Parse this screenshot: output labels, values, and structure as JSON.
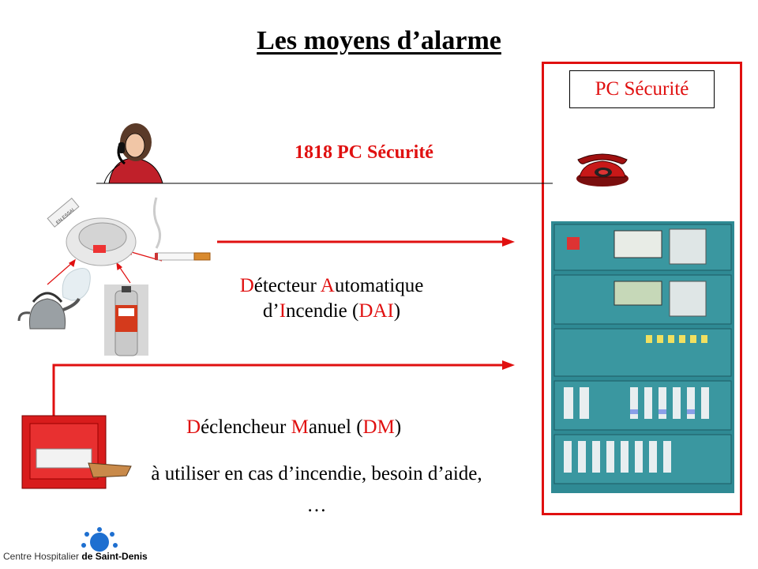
{
  "title": "Les moyens d’alarme",
  "pc_box": {
    "label": "PC Sécurité"
  },
  "phone_line": {
    "label": "1818  PC Sécurité"
  },
  "dai": {
    "line1": [
      {
        "t": "D",
        "red": true
      },
      {
        "t": "étecteur ",
        "red": false
      },
      {
        "t": "A",
        "red": true
      },
      {
        "t": "utomatique",
        "red": false
      }
    ],
    "line2": [
      {
        "t": "d’",
        "red": false
      },
      {
        "t": "I",
        "red": true
      },
      {
        "t": "ncendie (",
        "red": false
      },
      {
        "t": "DAI",
        "red": true
      },
      {
        "t": ")",
        "red": false
      }
    ]
  },
  "dm": {
    "line": [
      {
        "t": "D",
        "red": true
      },
      {
        "t": "éclencheur ",
        "red": false
      },
      {
        "t": "M",
        "red": true
      },
      {
        "t": "anuel (",
        "red": false
      },
      {
        "t": "DM",
        "red": true
      },
      {
        "t": ")",
        "red": false
      }
    ]
  },
  "usage": {
    "line1": "à utiliser en cas d’incendie, besoin d’aide,",
    "line2": "…"
  },
  "logo": {
    "prefix": "Centre Hospitalier ",
    "name": "de Saint-Denis"
  },
  "detector_tape": "EN ESSAI",
  "colors": {
    "accent": "#e01010",
    "panel": "#2a7f8a",
    "logo_blue": "#1e6fd0"
  }
}
